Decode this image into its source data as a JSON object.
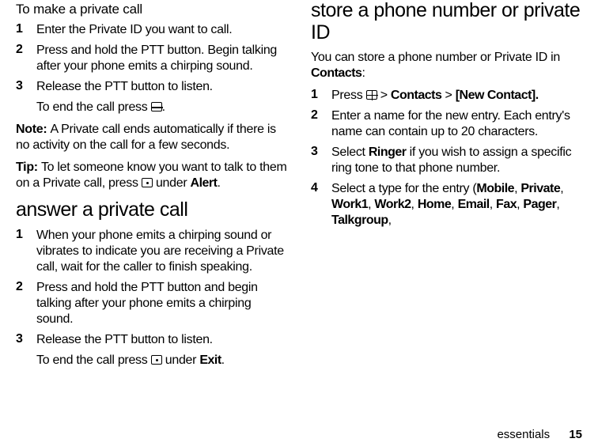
{
  "col1": {
    "subhead": "To make a private call",
    "step1": {
      "n": "1",
      "t": "Enter the Private ID you want to call."
    },
    "step2": {
      "n": "2",
      "t": "Press and hold the PTT button. Begin talking after your phone emits a chirping sound."
    },
    "step3": {
      "n": "3",
      "t": "Release the PTT button to listen."
    },
    "step3_end": {
      "pre": "To end the call press ",
      "post": "."
    },
    "note": {
      "label": "Note: ",
      "t": "A Private call ends automatically if there is no activity on the call for a few seconds."
    },
    "tip": {
      "label": "Tip: ",
      "t1": "To let someone know you want to talk to them on a Private call, press ",
      "t2": " under ",
      "alert": "Alert",
      "t3": "."
    },
    "h2": "answer a private call",
    "ans1": {
      "n": "1",
      "t": "When your phone emits a chirping sound or vibrates to indicate you are receiving a Private call, wait for the caller to finish speaking."
    }
  },
  "col2": {
    "ans2": {
      "n": "2",
      "t": "Press and hold the PTT button and begin talking after your phone emits a chirping sound."
    },
    "ans3": {
      "n": "3",
      "t": "Release the PTT button to listen."
    },
    "ans3_end": {
      "pre": "To end the call press ",
      "mid": " under ",
      "exit": "Exit",
      "post": "."
    },
    "h2a": "store a phone number or private ID",
    "intro": {
      "t1": "You can store a phone number or Private ID in ",
      "contacts": "Contacts",
      "t2": ":"
    },
    "s1": {
      "n": "1",
      "pre": "Press ",
      "gt1": " > ",
      "contacts": "Contacts",
      "gt2": " > ",
      "newc": "[New Contact]."
    },
    "s2": {
      "n": "2",
      "t": "Enter a name for the new entry. Each entry's name can contain up to 20 characters."
    },
    "s3": {
      "n": "3",
      "t1": "Select ",
      "ringer": "Ringer",
      "t2": " if you wish to assign a specific ring tone to that phone number."
    },
    "s4": {
      "n": "4",
      "t1": "Select a type for the entry (",
      "mobile": "Mobile",
      "c1": ", ",
      "private": "Private",
      "c2": ", ",
      "work1": "Work1",
      "c3": ", ",
      "work2": "Work2",
      "c4": ", ",
      "home": "Home",
      "c5": ", ",
      "email": "Email",
      "c6": ", ",
      "fax": "Fax",
      "c7": ", ",
      "pager": "Pager",
      "c8": ", ",
      "talkgroup": "Talkgroup",
      "c9": ","
    }
  },
  "footer": {
    "section": "essentials",
    "page": "15"
  }
}
